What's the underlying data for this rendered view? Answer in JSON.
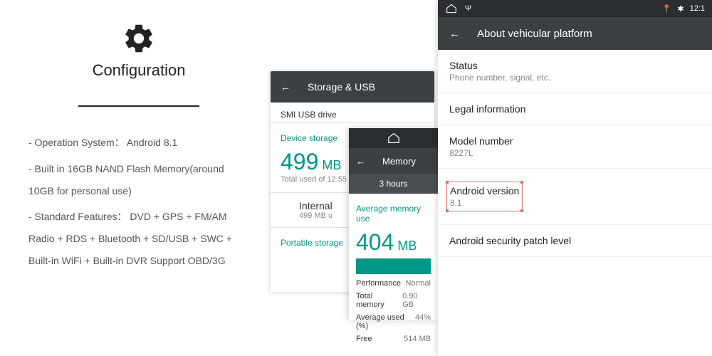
{
  "config": {
    "title": "Configuration",
    "line1": "- Operation System： Android 8.1",
    "line2": "- Built in 16GB NAND Flash Memory(around 10GB for personal use)",
    "line3": "- Standard Features： DVD + GPS + FM/AM Radio + RDS + Bluetooth + SD/USB + SWC + Built-in WiFi + Built-in DVR Support OBD/3G"
  },
  "storage": {
    "header": "Storage & USB",
    "smi": "SMI USB drive",
    "device_storage_label": "Device storage",
    "total_num": "499",
    "total_unit": " MB",
    "total_sub": "Total used of 12.55",
    "internal_title": "Internal",
    "internal_sub": "499 MB u",
    "portable_label": "Portable storage"
  },
  "memory": {
    "header": "Memory",
    "tab": "3 hours",
    "avg_label": "Average memory use",
    "avg_num": "404",
    "avg_unit": " MB",
    "perf_l": "Performance",
    "perf_v": "Normal",
    "tot_l": "Total memory",
    "tot_v": "0.90 GB",
    "avgp_l": "Average used (%)",
    "avgp_v": "44%",
    "free_l": "Free",
    "free_v": "514 MB"
  },
  "about": {
    "time": "12:1",
    "header": "About vehicular platform",
    "status_t": "Status",
    "status_s": "Phone number, signal, etc.",
    "legal_t": "Legal information",
    "model_t": "Model number",
    "model_s": "8227L",
    "android_t": "Android version",
    "android_s": "8.1",
    "patch_t": "Android security patch level"
  }
}
